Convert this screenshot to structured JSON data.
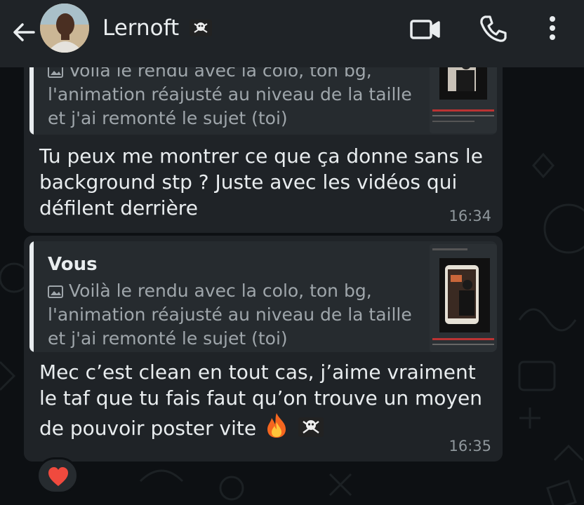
{
  "header": {
    "contact_name": "Lernoft",
    "name_emoji": "pirate-flag"
  },
  "messages": [
    {
      "quote_text": "Voilà le rendu avec la colo, ton bg, l'animation réajusté au niveau de la taille et j'ai remonté le sujet (toi)",
      "body": "Tu peux me montrer ce que ça donne sans le background stp ? Juste avec les vidéos qui défilent derrière",
      "time": "16:34"
    },
    {
      "quote_author": "Vous",
      "quote_text": "Voilà le rendu avec la colo, ton bg, l'animation réajusté au niveau de la taille et j'ai remonté le sujet (toi)",
      "body": "Mec c’est clean en tout cas, j’aime vraiment le taf que tu fais faut qu’on trouve un moyen de pouvoir poster vite",
      "body_emojis": [
        "fire",
        "pirate-flag"
      ],
      "time": "16:35",
      "reaction": "heart"
    }
  ],
  "colors": {
    "header_bg": "#1f2327",
    "bubble_bg": "#1f2327",
    "chat_bg": "#0d1013",
    "text": "#e9edef",
    "muted": "#9fa6ab"
  }
}
